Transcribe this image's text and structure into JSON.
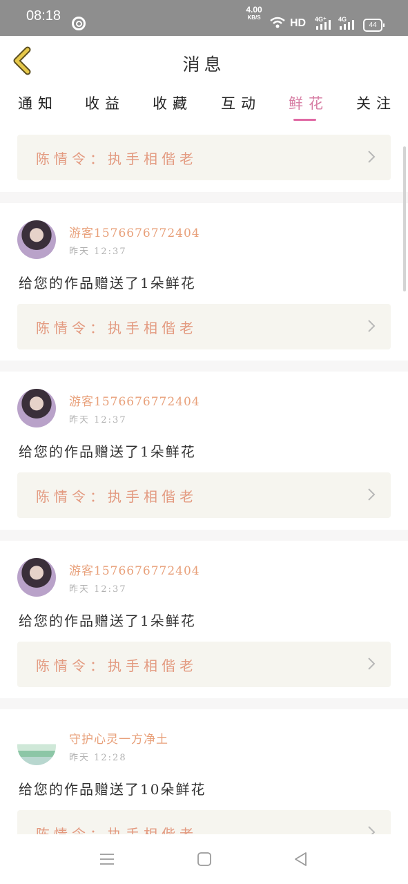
{
  "status_bar": {
    "time": "08:18",
    "net_speed_value": "4.00",
    "net_speed_unit": "KB/S",
    "hd_label": "HD",
    "signal1_label": "4G⁺",
    "signal2_label": "4G",
    "battery": "44"
  },
  "header": {
    "title": "消息",
    "back_icon": "chevron-left-icon",
    "accent_color": "#e6c84a"
  },
  "tabs": [
    {
      "label": "通知",
      "active": false
    },
    {
      "label": "收益",
      "active": false
    },
    {
      "label": "收藏",
      "active": false
    },
    {
      "label": "互动",
      "active": false
    },
    {
      "label": "鲜花",
      "active": true
    },
    {
      "label": "关注",
      "active": false
    }
  ],
  "colors": {
    "active_tab": "#d77ea4",
    "indicator": "#e069a4",
    "username": "#e8a07a",
    "work_title": "#e39a80",
    "card_bg": "#f6f5ef"
  },
  "feed": {
    "top_card": {
      "work_title": "陈情令：执手相偕老"
    },
    "items": [
      {
        "username": "游客1576676772404",
        "time": "昨天 12:37",
        "message": "给您的作品赠送了1朵鲜花",
        "work_title": "陈情令：执手相偕老",
        "avatar": "avatar-girl"
      },
      {
        "username": "游客1576676772404",
        "time": "昨天 12:37",
        "message": "给您的作品赠送了1朵鲜花",
        "work_title": "陈情令：执手相偕老",
        "avatar": "avatar-girl"
      },
      {
        "username": "游客1576676772404",
        "time": "昨天 12:37",
        "message": "给您的作品赠送了1朵鲜花",
        "work_title": "陈情令：执手相偕老",
        "avatar": "avatar-girl"
      },
      {
        "username": "守护心灵一方净土",
        "time": "昨天 12:28",
        "message": "给您的作品赠送了10朵鲜花",
        "work_title": "陈情令：执手相偕老",
        "avatar": "avatar-landscape"
      }
    ]
  },
  "nav_bar": {
    "menu_icon": "menu-icon",
    "home_icon": "home-square-icon",
    "back_icon": "back-triangle-icon"
  }
}
